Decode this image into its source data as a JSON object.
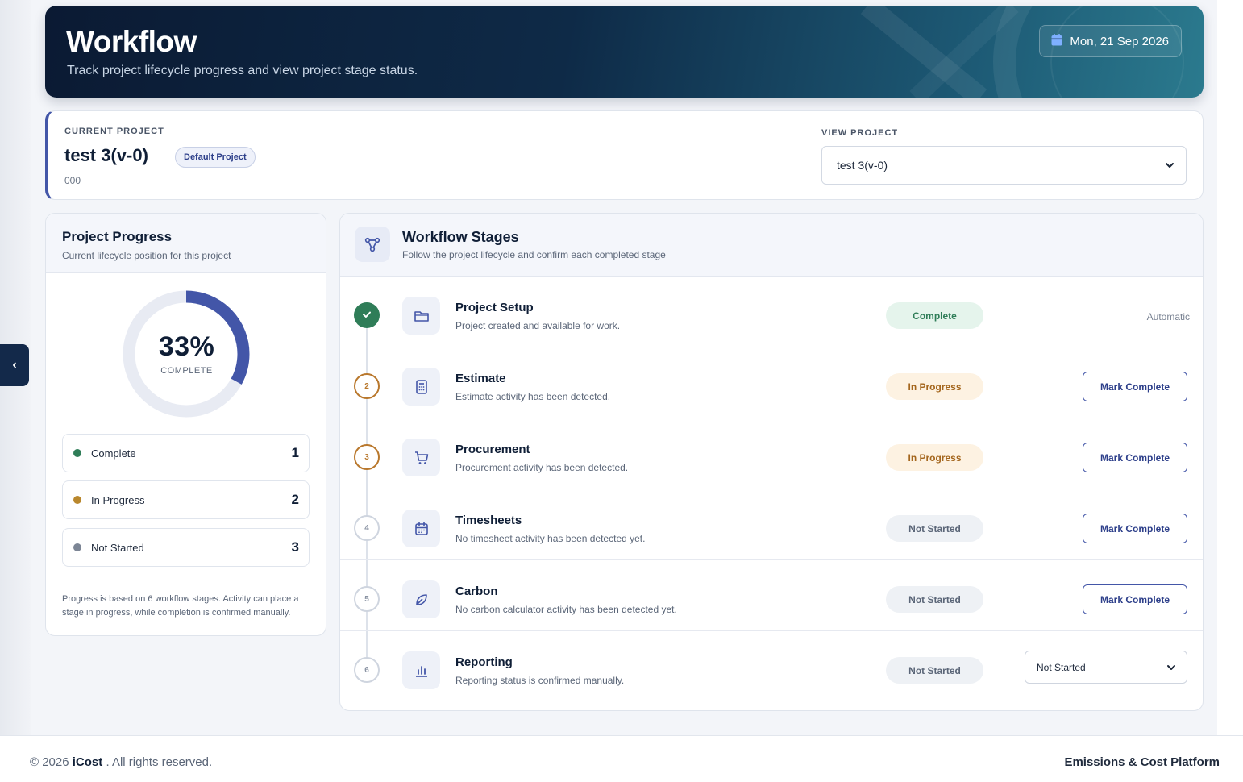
{
  "header": {
    "title": "Workflow",
    "subtitle": "Track project lifecycle progress and view project stage status.",
    "date": "Mon, 21 Sep 2026"
  },
  "current_project": {
    "label": "CURRENT PROJECT",
    "name": "test 3(v-0)",
    "badge": "Default Project",
    "code": "000"
  },
  "view_project": {
    "label": "VIEW PROJECT",
    "selected": "test 3(v-0)"
  },
  "progress": {
    "title": "Project Progress",
    "subtitle": "Current lifecycle position for this project",
    "percent_text": "33%",
    "percent_value": 33,
    "complete_label": "COMPLETE",
    "stats": [
      {
        "label": "Complete",
        "count": "1",
        "color": "#2f7d58"
      },
      {
        "label": "In Progress",
        "count": "2",
        "color": "#b9872d"
      },
      {
        "label": "Not Started",
        "count": "3",
        "color": "#7c8595"
      }
    ],
    "note": "Progress is based on 6 workflow stages. Activity can place a stage in progress, while completion is confirmed manually."
  },
  "workflow": {
    "title": "Workflow Stages",
    "subtitle": "Follow the project lifecycle and confirm each completed stage",
    "stages": [
      {
        "step": "1",
        "name": "Project Setup",
        "desc": "Project created and available for work.",
        "status": "Complete",
        "action": "Automatic"
      },
      {
        "step": "2",
        "name": "Estimate",
        "desc": "Estimate activity has been detected.",
        "status": "In Progress",
        "action": "Mark Complete"
      },
      {
        "step": "3",
        "name": "Procurement",
        "desc": "Procurement activity has been detected.",
        "status": "In Progress",
        "action": "Mark Complete"
      },
      {
        "step": "4",
        "name": "Timesheets",
        "desc": "No timesheet activity has been detected yet.",
        "status": "Not Started",
        "action": "Mark Complete"
      },
      {
        "step": "5",
        "name": "Carbon",
        "desc": "No carbon calculator activity has been detected yet.",
        "status": "Not Started",
        "action": "Mark Complete"
      },
      {
        "step": "6",
        "name": "Reporting",
        "desc": "Reporting status is confirmed manually.",
        "status": "Not Started",
        "action": "Not Started"
      }
    ]
  },
  "sidebar_toggle": "‹",
  "footer": {
    "copyright": "© 2026",
    "brand": "iCost",
    "rights": ". All rights reserved.",
    "platform": "Emissions & Cost Platform"
  }
}
